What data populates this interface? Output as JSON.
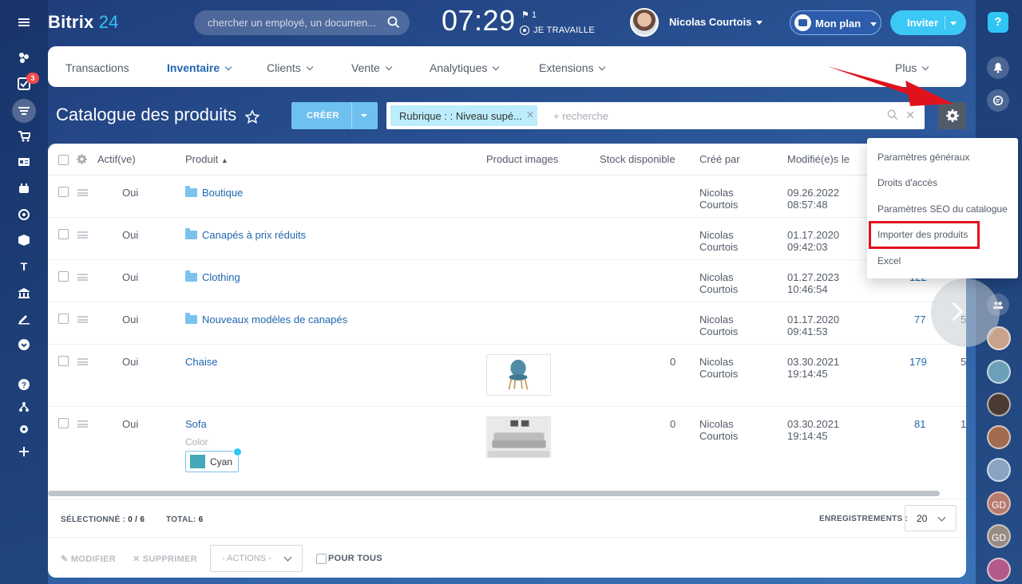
{
  "brand": {
    "name": "Bitrix",
    "number": "24"
  },
  "header": {
    "search_placeholder": "chercher un employé, un documen...",
    "clock": "07:29",
    "flag_count": "1",
    "work_status": "JE TRAVAILLE",
    "user_name": "Nicolas Courtois",
    "plan_button": "Mon plan",
    "invite_button": "Inviter"
  },
  "left_sidebar": {
    "tasks_badge": "3",
    "letter_item": "T"
  },
  "nav": {
    "items": [
      "Transactions",
      "Inventaire",
      "Clients",
      "Vente",
      "Analytiques",
      "Extensions"
    ],
    "more": "Plus",
    "active": "Inventaire"
  },
  "page": {
    "title": "Catalogue des produits",
    "create_button": "CRÉER",
    "filter_tag": "Rubrique : : Niveau supé...",
    "filter_placeholder": "+ recherche"
  },
  "table": {
    "columns": [
      "Actif(ve)",
      "Produit",
      "Product images",
      "Stock disponible",
      "Créé par",
      "Modifié(e)s le"
    ],
    "rows": [
      {
        "active": "Oui",
        "name": "Boutique",
        "folder": true,
        "stock": "",
        "created_by_1": "Nicolas",
        "created_by_2": "Courtois",
        "date": "09.26.2022",
        "time": "08:57:48",
        "id": "",
        "extra": ""
      },
      {
        "active": "Oui",
        "name": "Canapés à prix réduits",
        "folder": true,
        "stock": "",
        "created_by_1": "Nicolas",
        "created_by_2": "Courtois",
        "date": "01.17.2020",
        "time": "09:42:03",
        "id": "",
        "extra": ""
      },
      {
        "active": "Oui",
        "name": "Clothing",
        "folder": true,
        "stock": "",
        "created_by_1": "Nicolas",
        "created_by_2": "Courtois",
        "date": "01.27.2023",
        "time": "10:46:54",
        "id": "122",
        "extra": ""
      },
      {
        "active": "Oui",
        "name": "Nouveaux modèles de canapés",
        "folder": true,
        "stock": "",
        "created_by_1": "Nicolas",
        "created_by_2": "Courtois",
        "date": "01.17.2020",
        "time": "09:41:53",
        "id": "77",
        "extra": "5"
      },
      {
        "active": "Oui",
        "name": "Chaise",
        "folder": false,
        "stock": "0",
        "created_by_1": "Nicolas",
        "created_by_2": "Courtois",
        "date": "03.30.2021",
        "time": "19:14:45",
        "id": "179",
        "extra": "5"
      },
      {
        "active": "Oui",
        "name": "Sofa",
        "folder": false,
        "stock": "0",
        "created_by_1": "Nicolas",
        "created_by_2": "Courtois",
        "date": "03.30.2021",
        "time": "19:14:45",
        "id": "81",
        "extra": "1"
      }
    ],
    "sofa_color_label": "Color",
    "sofa_color_value": "Cyan"
  },
  "footer": {
    "selected_label": "SÉLECTIONNÉ :",
    "selected_value": "0 / 6",
    "total_label": "TOTAL:",
    "total_value": "6",
    "records_label": "ENREGISTREMENTS :",
    "records_value": "20",
    "edit": "MODIFIER",
    "delete": "SUPPRIMER",
    "actions": "- ACTIONS -",
    "for_all": "POUR TOUS"
  },
  "settings_menu": {
    "items": [
      "Paramètres généraux",
      "Droits d'accès",
      "Paramètres SEO du catalogue",
      "Importer des produits",
      "Excel"
    ],
    "highlighted": "Importer des produits"
  },
  "colors": {
    "accent": "#2fc6f6",
    "link": "#2067b0",
    "highlight": "#e0121c",
    "create": "#6ec0f0"
  }
}
